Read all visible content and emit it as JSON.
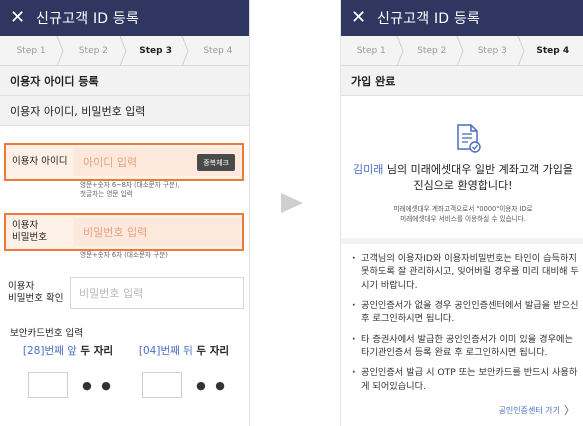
{
  "left": {
    "title": "신규고객 ID 등록",
    "close_icon": "close-icon",
    "steps": [
      "Step 1",
      "Step 2",
      "Step 3",
      "Step 4"
    ],
    "active_step": 3,
    "section_title": "이용자 아이디 등록",
    "sub_title": "이용자 아이디, 비밀번호 입력",
    "id_row": {
      "label": "이용자 아이디",
      "placeholder": "아이디 입력",
      "dup_button": "중복체크",
      "hint": [
        "영문+숫자 6~8자 (대소문자 구분),",
        "첫글자는 영문 입력"
      ]
    },
    "pw_row": {
      "label": [
        "이용자",
        "비밀번호"
      ],
      "placeholder": "비밀번호 입력",
      "hint": "영문+숫자 6자 (대소문자 구분)"
    },
    "pw_confirm_row": {
      "label": [
        "이용자",
        "비밀번호 확인"
      ],
      "placeholder": "비밀번호 입력"
    },
    "card": {
      "label": "보안카드번호 입력",
      "first": {
        "num": "[28]번째",
        "pos": " 앞",
        "rest": " 두 자리"
      },
      "second": {
        "num": "[04]번째",
        "pos": " 뒤",
        "rest": " 두 자리"
      },
      "dots": "● ●"
    }
  },
  "right": {
    "title": "신규고객 ID 등록",
    "close_icon": "close-icon",
    "steps": [
      "Step 1",
      "Step 2",
      "Step 3",
      "Step 4"
    ],
    "active_step": 4,
    "section_title": "가입 완료",
    "icon": "document-check-icon",
    "welcome": {
      "name": "김미래",
      "line1_rest": " 님의 미래에셋대우 일반 계좌고객 가입을",
      "line2": "진심으로 환영합니다!"
    },
    "welcome_sub": [
      "미래에셋대우 계좌고객으로서 \"0000\"이용자 ID로",
      "미래에셋대우 서비스를 이용하실 수 있습니다."
    ],
    "notes": [
      "고객님의 이용자ID와 이용자비밀번호는 타인이 습득하지 못하도록 잘 관리하시고, 잊어버릴 경우를 미리 대비해 두시기 바랍니다.",
      "공인인증서가 없을 경우 공인인증센터에서 발급을 받으신 후 로그인하시면 됩니다.",
      "타 증권사에서 발급한 공인인증서가 이미 있을 경우에는 타기관인증서 등록 완료 후 로그인하시면 됩니다.",
      "공인인증서 발급 시 OTP 또는 보안카드를 반드시 사용하게 되어있습니다."
    ],
    "cert_link": "공인인증센터 가기",
    "cert_link_icon": "chevron-right-icon"
  },
  "colors": {
    "header": "#2f3761",
    "highlight": "#ee7a3a",
    "accent_blue": "#4a6cc4"
  }
}
